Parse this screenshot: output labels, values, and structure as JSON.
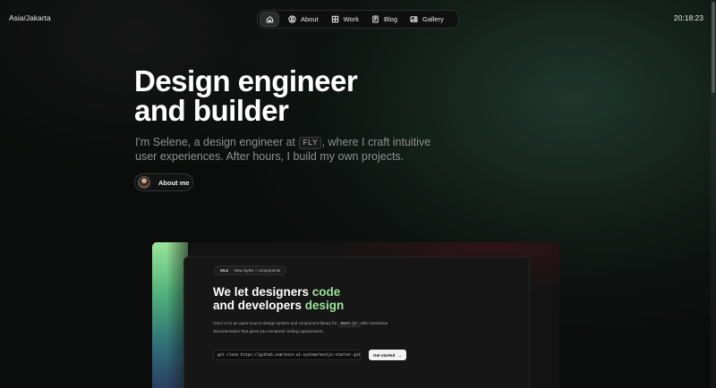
{
  "header": {
    "timezone": "Asia/Jakarta",
    "time": "20:18:23",
    "nav": [
      {
        "label": "",
        "icon": "home-icon"
      },
      {
        "label": "About",
        "icon": "user-circle-icon"
      },
      {
        "label": "Work",
        "icon": "grid-icon"
      },
      {
        "label": "Blog",
        "icon": "book-icon"
      },
      {
        "label": "Gallery",
        "icon": "image-icon"
      }
    ]
  },
  "hero": {
    "title_line1": "Design engineer",
    "title_line2": "and builder",
    "subtitle_before": "I'm Selene, a design engineer at ",
    "subtitle_code": "FLY",
    "subtitle_after": ", where I craft intuitive user experiences. After hours, I build my own projects.",
    "about_button": "About me"
  },
  "preview": {
    "version": "v0.4",
    "version_note": "New styles + components",
    "title_part1": "We let designers ",
    "title_accent1": "code",
    "title_part2": "and developers ",
    "title_accent2": "design",
    "desc_before": "Once UI is an open-source design system and component library for ",
    "desc_code": "Next.js",
    "desc_after": " with interactive documentation that gives you unnatural coding superpowers.",
    "command": "git clone https://github.com/once-ui-system/nextjs-starter.git",
    "cta": "Get started",
    "cta_arrow": "→"
  },
  "colors": {
    "accent_green": "#9be39b",
    "background": "#0b0d0c"
  }
}
